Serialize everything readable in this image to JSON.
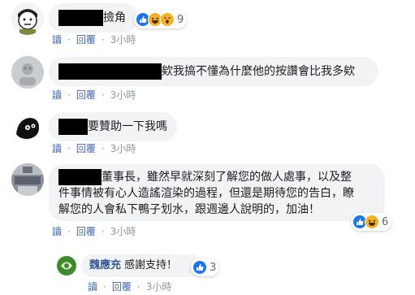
{
  "actions": {
    "read": "讀",
    "reply": "回覆",
    "separator": "·"
  },
  "comments": [
    {
      "text": "撿角",
      "reaction_count": "9",
      "time": "3小時",
      "reactions": [
        "like-icon",
        "haha-icon",
        "wow-icon"
      ]
    },
    {
      "text": "欸我搞不懂為什麼他的按讚會比我多欸",
      "time": "3小時"
    },
    {
      "text": "要贊助一下我嗎",
      "time": "3小時"
    },
    {
      "lines": [
        "董事長，雖然早就深刻了解您的做人處事，以及整",
        "件事情被有心人造謠渲染的過程，但還是期待您的告白，瞭",
        "解您的人會私下鴨子划水，跟週邊人說明的，加油！"
      ],
      "reaction_count": "6",
      "time": "3小時",
      "reactions": [
        "like-icon",
        "haha-icon"
      ]
    },
    {
      "name": "魏應充",
      "text": "感謝支持！",
      "reaction_count": "3",
      "time": "3小時",
      "reactions": [
        "like-icon"
      ]
    }
  ],
  "colors": {
    "link": "#4267b2",
    "name": "#385898",
    "bubble": "#f2f3f5",
    "like": "#1877f2",
    "haha": "#f7b125"
  }
}
